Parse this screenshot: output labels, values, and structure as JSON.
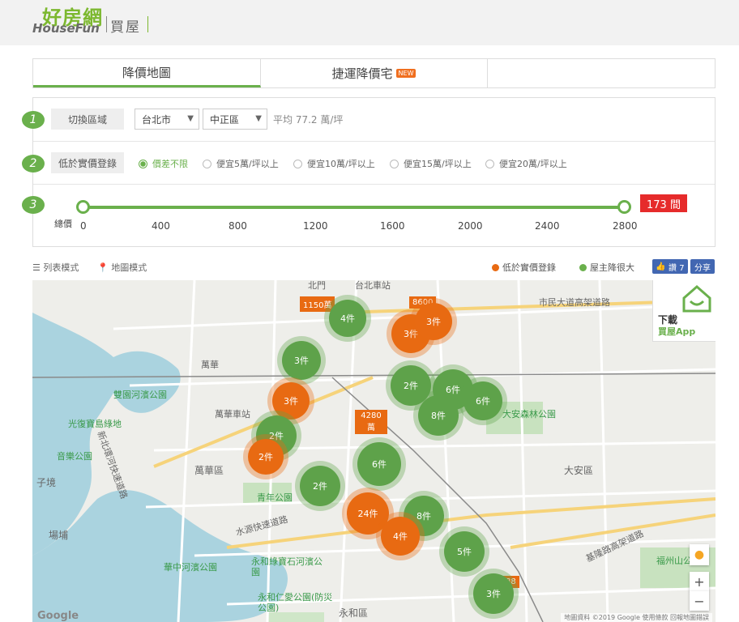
{
  "header": {
    "logo_cn": "好房網",
    "logo_en": "HouseFun",
    "section": "買屋"
  },
  "tabs": [
    {
      "label": "降價地圖",
      "active": true
    },
    {
      "label": "捷運降價宅",
      "badge": "NEW"
    },
    {
      "label": ""
    }
  ],
  "filters": {
    "step1": "1",
    "step2": "2",
    "step3": "3",
    "region_label": "切換區域",
    "city": "台北市",
    "district": "中正區",
    "avg_price": "平均 77.2 萬/坪",
    "price_label": "低於實價登錄",
    "options": [
      "價差不限",
      "便宜5萬/坪以上",
      "便宜10萬/坪以上",
      "便宜15萬/坪以上",
      "便宜20萬/坪以上"
    ],
    "selected_option": "價差不限",
    "total_label": "總價",
    "ticks": [
      "0",
      "400",
      "800",
      "1200",
      "1600",
      "2000",
      "2400",
      "2800"
    ],
    "range_min": 0,
    "range_max": 2800,
    "result_count": "173 間"
  },
  "view": {
    "list_mode": "列表模式",
    "map_mode": "地圖模式",
    "legend_orange": "低於實價登錄",
    "legend_green": "屋主降很大",
    "like_label": "讚 7",
    "share_label": "分享"
  },
  "colors": {
    "green": "#6ab04c",
    "orange": "#e86a12",
    "red": "#e62b2b",
    "facebook": "#4267b2"
  },
  "map": {
    "labels": [
      {
        "text": "北門",
        "kind": "place"
      },
      {
        "text": "台北車站",
        "kind": "place"
      },
      {
        "text": "萬華",
        "kind": "place"
      },
      {
        "text": "萬華車站",
        "kind": "place"
      },
      {
        "text": "萬華區",
        "kind": "district"
      },
      {
        "text": "大安區",
        "kind": "district"
      },
      {
        "text": "永和區",
        "kind": "district"
      },
      {
        "text": "雙園河濱公園",
        "kind": "park"
      },
      {
        "text": "光復寶島綠地",
        "kind": "park"
      },
      {
        "text": "音樂公園",
        "kind": "park"
      },
      {
        "text": "青年公園",
        "kind": "park"
      },
      {
        "text": "華中河濱公園",
        "kind": "park"
      },
      {
        "text": "永和綠寶石河濱公園",
        "kind": "park"
      },
      {
        "text": "永和仁愛公園(防災公園)",
        "kind": "park"
      },
      {
        "text": "大安森林公園",
        "kind": "park"
      },
      {
        "text": "福州山公園",
        "kind": "park"
      },
      {
        "text": "市民大道高架道路",
        "kind": "road"
      },
      {
        "text": "水源快速道路",
        "kind": "road"
      },
      {
        "text": "基隆路高架道路",
        "kind": "road"
      },
      {
        "text": "新北環河快速道路",
        "kind": "road"
      },
      {
        "text": "子境",
        "kind": "place"
      },
      {
        "text": "場埔",
        "kind": "place"
      }
    ],
    "clusters": [
      {
        "label": "4件",
        "color": "green"
      },
      {
        "label": "3件",
        "color": "green"
      },
      {
        "label": "3件",
        "color": "orange"
      },
      {
        "label": "2件",
        "color": "green"
      },
      {
        "label": "2件",
        "color": "orange"
      },
      {
        "label": "3件",
        "color": "orange"
      },
      {
        "label": "2件",
        "color": "green"
      },
      {
        "label": "6件",
        "color": "green"
      },
      {
        "label": "6件",
        "color": "green"
      },
      {
        "label": "8件",
        "color": "green"
      },
      {
        "label": "6件",
        "color": "green"
      },
      {
        "label": "2件",
        "color": "green"
      },
      {
        "label": "24件",
        "color": "orange"
      },
      {
        "label": "8件",
        "color": "green"
      },
      {
        "label": "4件",
        "color": "orange"
      },
      {
        "label": "5件",
        "color": "green"
      },
      {
        "label": "3件",
        "color": "green"
      }
    ],
    "price_boxes": [
      "1150萬",
      "4280萬",
      "8600",
      "88"
    ],
    "app_promo": {
      "line1": "下載",
      "line2": "買屋App"
    },
    "attribution": "地圖資料 ©2019 Google  使用條款  回報地圖錯誤",
    "google": "Google"
  }
}
